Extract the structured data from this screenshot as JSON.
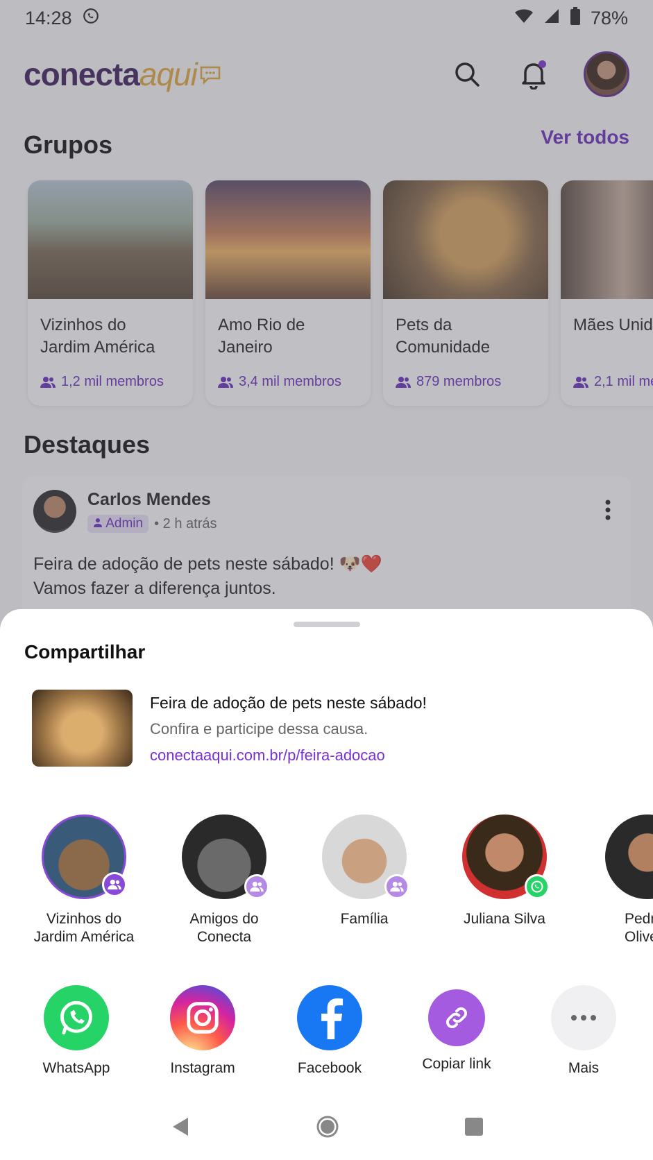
{
  "status_bar": {
    "time": "14:28",
    "battery": "78%"
  },
  "header": {
    "logo_part1": "conecta",
    "logo_part2": "aqui"
  },
  "groups_section": {
    "title": "Grupos",
    "see_all": "Ver todos",
    "items": [
      {
        "name": "Vizinhos do Jardim América",
        "members": "1,2 mil membros"
      },
      {
        "name": "Amo Rio de Janeiro",
        "members": "3,4 mil membros"
      },
      {
        "name": "Pets da Comunidade",
        "members": "879 membros"
      },
      {
        "name": "Mães Unidas",
        "members": "2,1 mil me"
      }
    ]
  },
  "highlights": {
    "title": "Destaques",
    "post": {
      "author": "Carlos Mendes",
      "role": "Admin",
      "time": "• 2 h atrás",
      "text_line1": "Feira de adoção de pets neste sábado! 🐶❤️",
      "text_line2": "Vamos fazer a diferença juntos."
    }
  },
  "share_sheet": {
    "title": "Compartilhar",
    "preview": {
      "title": "Feira de adoção de pets neste sábado!",
      "description": "Confira e participe dessa causa.",
      "link": "conectaaqui.com.br/p/feira-adocao"
    },
    "contacts": [
      {
        "name_line1": "Vizinhos do",
        "name_line2": "Jardim América"
      },
      {
        "name_line1": "Amigos do",
        "name_line2": "Conecta"
      },
      {
        "name_line1": "Família",
        "name_line2": ""
      },
      {
        "name_line1": "Juliana Silva",
        "name_line2": ""
      },
      {
        "name_line1": "Pedr",
        "name_line2": "Olivei"
      }
    ],
    "apps": [
      {
        "label": "WhatsApp"
      },
      {
        "label": "Instagram"
      },
      {
        "label": "Facebook"
      },
      {
        "label": "Copiar link"
      },
      {
        "label": "Mais"
      }
    ]
  },
  "colors": {
    "accent": "#6a2dbf",
    "whatsapp": "#25d366",
    "facebook": "#1877f2",
    "logo_dark": "#3a1d5c",
    "logo_gold": "#e2a73a"
  }
}
